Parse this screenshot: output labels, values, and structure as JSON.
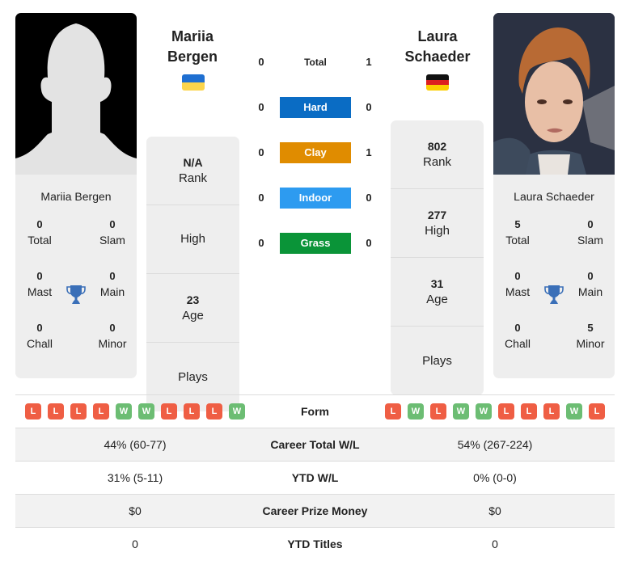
{
  "colors": {
    "hard": "#0a6cc4",
    "clay": "#e08c00",
    "indoor": "#2d9bf0",
    "grass": "#0a9438",
    "win": "#6cbd73",
    "loss": "#ef5e44",
    "trophy": "#3a6fb8",
    "panel_bg": "#eeeeee"
  },
  "player1": {
    "name_line1": "Mariia",
    "name_line2": "Bergen",
    "full_name": "Mariia Bergen",
    "flag": "ukraine-flag",
    "photo": "silhouette-placeholder",
    "titles": {
      "total": "0",
      "total_label": "Total",
      "slam": "0",
      "slam_label": "Slam",
      "mast": "0",
      "mast_label": "Mast",
      "main": "0",
      "main_label": "Main",
      "chall": "0",
      "chall_label": "Chall",
      "minor": "0",
      "minor_label": "Minor"
    },
    "rank": {
      "value": "N/A",
      "label": "Rank"
    },
    "high": {
      "value": "",
      "label": "High"
    },
    "age": {
      "value": "23",
      "label": "Age"
    },
    "plays": {
      "value": "",
      "label": "Plays"
    },
    "form": [
      "L",
      "L",
      "L",
      "L",
      "W",
      "W",
      "L",
      "L",
      "L",
      "W"
    ],
    "career_wl": "44% (60-77)",
    "ytd_wl": "31% (5-11)",
    "prize_money": "$0",
    "ytd_titles": "0"
  },
  "player2": {
    "name_line1": "Laura",
    "name_line2": "Schaeder",
    "full_name": "Laura Schaeder",
    "flag": "germany-flag",
    "photo": "player-photo",
    "titles": {
      "total": "5",
      "total_label": "Total",
      "slam": "0",
      "slam_label": "Slam",
      "mast": "0",
      "mast_label": "Mast",
      "main": "0",
      "main_label": "Main",
      "chall": "0",
      "chall_label": "Chall",
      "minor": "5",
      "minor_label": "Minor"
    },
    "rank": {
      "value": "802",
      "label": "Rank"
    },
    "high": {
      "value": "277",
      "label": "High"
    },
    "age": {
      "value": "31",
      "label": "Age"
    },
    "plays": {
      "value": "",
      "label": "Plays"
    },
    "form": [
      "L",
      "W",
      "L",
      "W",
      "W",
      "L",
      "L",
      "L",
      "W",
      "L"
    ],
    "career_wl": "54% (267-224)",
    "ytd_wl": "0% (0-0)",
    "prize_money": "$0",
    "ytd_titles": "0"
  },
  "h2h": {
    "total": {
      "label": "Total",
      "p1": "0",
      "p2": "1"
    },
    "surfaces": [
      {
        "label": "Hard",
        "p1": "0",
        "p2": "0"
      },
      {
        "label": "Clay",
        "p1": "0",
        "p2": "1"
      },
      {
        "label": "Indoor",
        "p1": "0",
        "p2": "0"
      },
      {
        "label": "Grass",
        "p1": "0",
        "p2": "0"
      }
    ]
  },
  "table": {
    "form_label": "Form",
    "career_wl_label": "Career Total W/L",
    "ytd_wl_label": "YTD W/L",
    "prize_label": "Career Prize Money",
    "ytd_titles_label": "YTD Titles"
  }
}
